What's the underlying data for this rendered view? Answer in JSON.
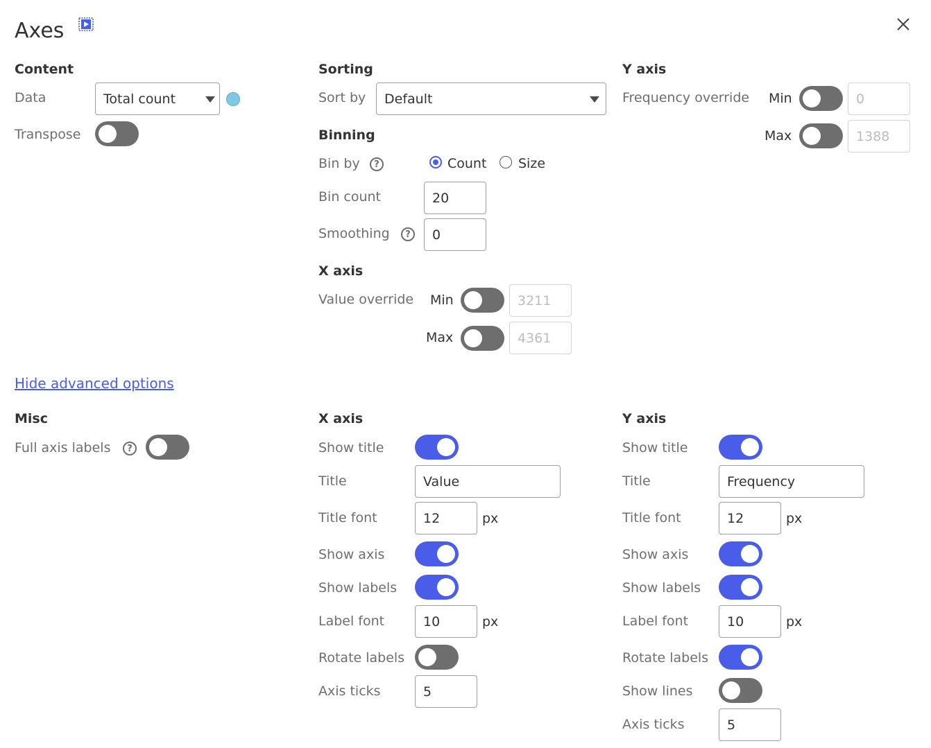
{
  "header": {
    "title": "Axes",
    "video_icon": "video-tutorial-icon",
    "close_icon": "close-icon"
  },
  "content": {
    "heading": "Content",
    "data_label": "Data",
    "data_value": "Total count",
    "data_color": "#7ec8e3",
    "transpose_label": "Transpose",
    "transpose_on": false
  },
  "sorting": {
    "heading": "Sorting",
    "sort_by_label": "Sort by",
    "sort_by_value": "Default"
  },
  "binning": {
    "heading": "Binning",
    "bin_by_label": "Bin by",
    "bin_by_options": [
      "Count",
      "Size"
    ],
    "bin_by_selected": "Count",
    "bin_count_label": "Bin count",
    "bin_count_value": "20",
    "smoothing_label": "Smoothing",
    "smoothing_value": "0"
  },
  "x_axis_basic": {
    "heading": "X axis",
    "value_override_label": "Value override",
    "min_label": "Min",
    "min_placeholder": "3211",
    "max_label": "Max",
    "max_placeholder": "4361"
  },
  "y_axis_basic": {
    "heading": "Y axis",
    "frequency_override_label": "Frequency override",
    "min_label": "Min",
    "min_placeholder": "0",
    "max_label": "Max",
    "max_placeholder": "1388"
  },
  "advanced_link": "Hide advanced options",
  "misc": {
    "heading": "Misc",
    "full_axis_labels_label": "Full axis labels",
    "full_axis_labels_on": false
  },
  "x_axis_adv": {
    "heading": "X axis",
    "show_title_label": "Show title",
    "title_label": "Title",
    "title_value": "Value",
    "title_font_label": "Title font",
    "title_font_value": "12",
    "px": "px",
    "show_axis_label": "Show axis",
    "show_labels_label": "Show labels",
    "label_font_label": "Label font",
    "label_font_value": "10",
    "rotate_labels_label": "Rotate labels",
    "axis_ticks_label": "Axis ticks",
    "axis_ticks_value": "5"
  },
  "y_axis_adv": {
    "heading": "Y axis",
    "show_title_label": "Show title",
    "title_label": "Title",
    "title_value": "Frequency",
    "title_font_label": "Title font",
    "title_font_value": "12",
    "px": "px",
    "show_axis_label": "Show axis",
    "show_labels_label": "Show labels",
    "label_font_label": "Label font",
    "label_font_value": "10",
    "rotate_labels_label": "Rotate labels",
    "show_lines_label": "Show lines",
    "axis_ticks_label": "Axis ticks",
    "axis_ticks_value": "5"
  },
  "colors": {
    "accent": "#4a5de8",
    "toggle_off": "#6e6e6e"
  }
}
